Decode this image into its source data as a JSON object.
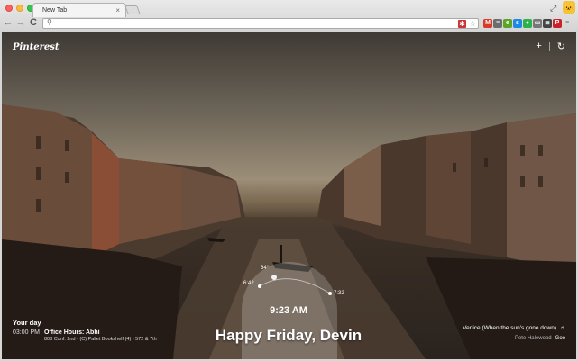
{
  "browser": {
    "tab_title": "New Tab",
    "tab_close": "×",
    "omnibox_value": "",
    "nav_back": "←",
    "nav_forward": "→",
    "nav_reload": "C",
    "search_glyph": "⚲",
    "star_glyph": "☆",
    "expand_glyph": "⤢",
    "profile_glyph": "🐱",
    "extensions": [
      {
        "name": "gmail-extension",
        "glyph": "M",
        "color": "#d63b2b"
      },
      {
        "name": "reader-extension",
        "glyph": "≡",
        "color": "#6d6d6d"
      },
      {
        "name": "evernote-extension",
        "glyph": "e",
        "color": "#5ba525"
      },
      {
        "name": "shield-extension",
        "glyph": "s",
        "color": "#1e88e5"
      },
      {
        "name": "feedly-extension",
        "glyph": "●",
        "color": "#2bb24c"
      },
      {
        "name": "window-extension",
        "glyph": "▭",
        "color": "#777777"
      },
      {
        "name": "reader-list-extension",
        "glyph": "≣",
        "color": "#444444"
      },
      {
        "name": "pinterest-extension",
        "glyph": "P",
        "color": "#cb2027"
      },
      {
        "name": "menu",
        "glyph": "≡",
        "color": "#666666"
      }
    ]
  },
  "page": {
    "logo": "Pinterest",
    "add_glyph": "+",
    "refresh_glyph": "↻",
    "time": "9:23 AM",
    "greeting": "Happy Friday, Devin",
    "sun": {
      "temperature": "64°",
      "sunrise": "6:42",
      "sunset": "7:32"
    },
    "day": {
      "title": "Your day",
      "events": [
        {
          "time": "03:00 PM",
          "title": "Office Hours: Abhi",
          "detail": "808 Conf. 2nd - (C) Pallet Bookshelf (4) - 572 & 7th"
        }
      ]
    },
    "credit": {
      "title": "Venice (When the sun's gone down)",
      "author": "Pete Halewood",
      "title_icon": "♬",
      "author_icon": "Goo"
    }
  }
}
